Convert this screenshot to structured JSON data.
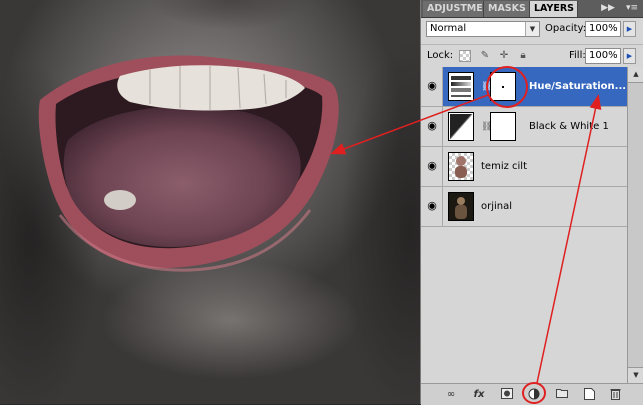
{
  "panel": {
    "tabs": [
      {
        "label": "ADJUSTMENTS",
        "active": false
      },
      {
        "label": "MASKS",
        "active": false
      },
      {
        "label": "LAYERS",
        "active": true
      }
    ],
    "collapse_icon": "double-chevron-right-icon",
    "menu_icon": "panel-menu-icon",
    "blend_mode": "Normal",
    "opacity_label": "Opacity:",
    "opacity_value": "100%",
    "lock_label": "Lock:",
    "lock_icons": [
      "lock-transparent-icon",
      "lock-brush-icon",
      "lock-move-icon",
      "lock-all-icon"
    ],
    "fill_label": "Fill:",
    "fill_value": "100%",
    "layers": [
      {
        "name": "Hue/Saturation...",
        "selected": true,
        "thumb": "hue-saturation-adjustment-icon",
        "mask": true
      },
      {
        "name": "Black & White 1",
        "selected": false,
        "thumb": "black-white-adjustment-icon",
        "mask": true
      },
      {
        "name": "temiz cilt",
        "selected": false,
        "thumb": "skin-layer-thumbnail",
        "mask": false
      },
      {
        "name": "orjinal",
        "selected": false,
        "thumb": "original-photo-thumbnail",
        "mask": false
      }
    ],
    "bottom_icons": [
      "link-layers-icon",
      "fx-icon",
      "add-mask-icon",
      "new-adjustment-layer-icon",
      "new-group-icon",
      "new-layer-icon",
      "trash-icon"
    ]
  },
  "colors": {
    "selection": "#3768c0",
    "annotation": "#e02020",
    "panel_bg": "#d6d6d6"
  }
}
